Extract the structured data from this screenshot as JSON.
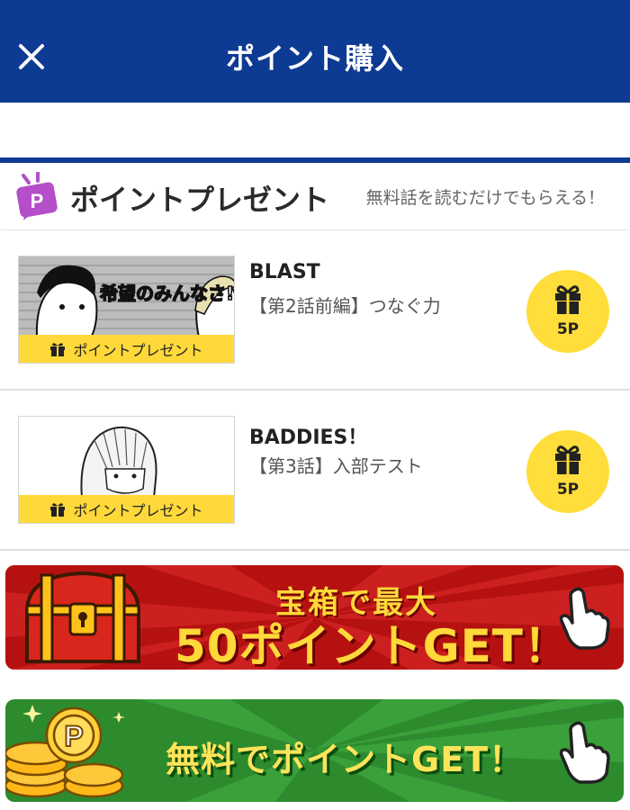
{
  "header": {
    "title": "ポイント購入",
    "close_icon": "close-icon",
    "bg_color": "#0d3a92"
  },
  "section": {
    "badge_letter": "P",
    "title": "ポイントプレゼント",
    "subtitle": "無料話を読むだけでもらえる！"
  },
  "items": [
    {
      "title": "BLAST",
      "episode": "【第2話前編】つなぐ力",
      "thumb_label": "ポイントプレゼント",
      "thumb_text": "希望のみんなさ! 場で",
      "points": "5P"
    },
    {
      "title": "BADDIES！",
      "episode": "【第3話】入部テスト",
      "thumb_label": "ポイントプレゼント",
      "points": "5P"
    }
  ],
  "banners": {
    "treasure": {
      "line1": "宝箱で最大",
      "line2": "50ポイントGET！",
      "color": "#b51111"
    },
    "free": {
      "text": "無料でポイントGET！",
      "color": "#2d8a2d"
    }
  },
  "accent_yellow": "#ffd83a"
}
